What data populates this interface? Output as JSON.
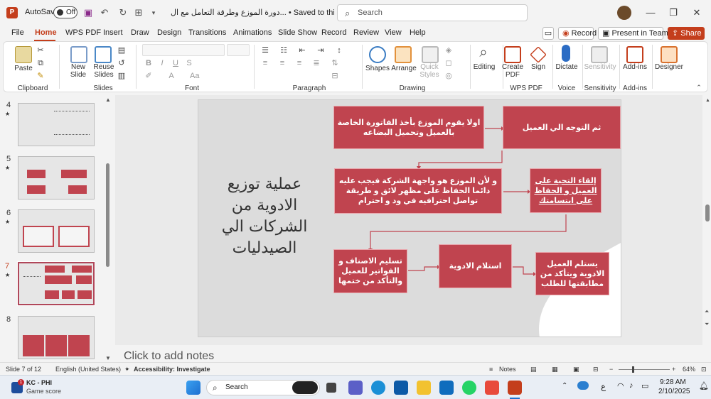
{
  "titlebar": {
    "app_icon": "P",
    "autosave_label": "AutoSave",
    "autosave_state": "Off",
    "doc_title": "دورة الموزع وطرقة التعامل مع ال... • Saved to this PC",
    "search_placeholder": "Search"
  },
  "tabs": [
    "File",
    "Home",
    "WPS PDF",
    "Insert",
    "Draw",
    "Design",
    "Transitions",
    "Animations",
    "Slide Show",
    "Record",
    "Review",
    "View",
    "Help"
  ],
  "top_actions": {
    "record": "Record",
    "present_teams": "Present in Teams",
    "share": "Share"
  },
  "ribbon": {
    "paste": "Paste",
    "new_slide": "New Slide",
    "reuse_slides": "Reuse Slides",
    "shapes": "Shapes",
    "arrange": "Arrange",
    "quick_styles": "Quick Styles",
    "editing": "Editing",
    "create_pdf": "Create PDF",
    "sign": "Sign",
    "dictate": "Dictate",
    "sensitivity": "Sensitivity",
    "add_ins": "Add-ins",
    "designer": "Designer",
    "groups": {
      "clipboard": "Clipboard",
      "slides": "Slides",
      "font": "Font",
      "paragraph": "Paragraph",
      "drawing": "Drawing",
      "wps_pdf": "WPS PDF",
      "voice": "Voice",
      "sensitivity": "Sensitivity",
      "add_ins": "Add-ins"
    }
  },
  "thumbnails": [
    {
      "num": "4",
      "star": "★"
    },
    {
      "num": "5",
      "star": "★"
    },
    {
      "num": "6",
      "star": "★"
    },
    {
      "num": "7",
      "star": "★"
    },
    {
      "num": "8",
      "star": ""
    }
  ],
  "slide": {
    "title": "عملية توزيع الادوية من الشركات الي الصيدليات",
    "boxes": {
      "b1": "اولا يقوم الموزع بأخذ الفاتورة الخاصة بالعميل وتحميل البضاعه",
      "b2": "ثم التوجه الي العميل",
      "b3": "و لأن الموزع هو واجهة الشركة فيجب عليه دائما الحفاظ على مظهر لائق و طريقة تواصل احترافيه في ود و احترام",
      "b4": "إلقاء التحية على العميل و الحفاظ على ابتسامتك",
      "b5": "تسليم الاصناف و الفواتير للعميل والتأكد من ختمها",
      "b6": "استلام الادوية",
      "b7": "يستلم العميل الادوية ويتأكد من مطابقتها للطلب"
    }
  },
  "notes_placeholder": "Click to add notes",
  "status": {
    "slide_of": "Slide 7 of 12",
    "language": "English (United States)",
    "accessibility": "Accessibility: Investigate",
    "notes": "Notes",
    "zoom": "64%"
  },
  "taskbar": {
    "weather_title": "KC - PHI",
    "weather_sub": "Game score",
    "badge": "1",
    "search": "Search",
    "lang": "ع",
    "time": "9:28 AM",
    "date": "2/10/2025"
  },
  "colors": {
    "accent": "#c43e1c",
    "box_fill": "#c0444f",
    "arrow": "#c0444f"
  }
}
